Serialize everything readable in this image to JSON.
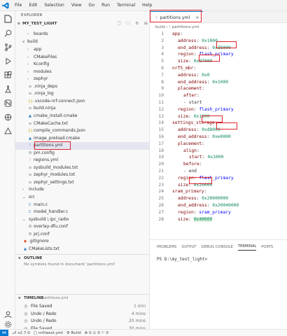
{
  "menu": [
    "File",
    "Edit",
    "Selection",
    "View",
    "Go",
    "Run",
    "Terminal",
    "Help"
  ],
  "sidebar": {
    "explorer_title": "EXPLORER",
    "project": "MY_TEST_LIGHT",
    "tree": [
      {
        "label": "boards",
        "icon": "folder",
        "depth": 2,
        "chev": ">"
      },
      {
        "label": "app",
        "icon": "folder",
        "depth": 2,
        "chev": ">"
      },
      {
        "label": "CMakeFiles",
        "icon": "folder",
        "depth": 2,
        "chev": ">"
      },
      {
        "label": "Kconfig",
        "icon": "folder",
        "depth": 2,
        "chev": ">"
      },
      {
        "label": "modules",
        "icon": "folder",
        "depth": 2,
        "chev": ">"
      },
      {
        "label": "zephyr",
        "icon": "folder",
        "depth": 2,
        "chev": ">"
      },
      {
        "label": ".ninja_deps",
        "icon": "file",
        "depth": 2
      },
      {
        "label": ".ninja_log",
        "icon": "file",
        "depth": 2
      },
      {
        "label": ".vscode-nrf-connect.json",
        "icon": "json",
        "depth": 2
      },
      {
        "label": "build.ninja",
        "icon": "file",
        "depth": 2
      },
      {
        "label": "cmake_install.cmake",
        "icon": "cmake",
        "depth": 2
      },
      {
        "label": "CMakeCache.txt",
        "icon": "file",
        "depth": 2
      },
      {
        "label": "compile_commands.json",
        "icon": "json",
        "depth": 2
      },
      {
        "label": "image_preload.cmake",
        "icon": "cmake",
        "depth": 2
      },
      {
        "label": "partitions.yml",
        "icon": "yml",
        "depth": 2
      },
      {
        "label": "pm.config",
        "icon": "gear",
        "depth": 2
      },
      {
        "label": "regions.yml",
        "icon": "yml",
        "depth": 2
      },
      {
        "label": "sysbuild_modules.txt",
        "icon": "file",
        "depth": 2
      },
      {
        "label": "zephyr_modules.txt",
        "icon": "file",
        "depth": 2
      },
      {
        "label": "zephyr_settings.txt",
        "icon": "file",
        "depth": 2
      },
      {
        "label": "include",
        "icon": "folder",
        "depth": 1,
        "chev": ">"
      },
      {
        "label": "src",
        "icon": "folder",
        "depth": 1,
        "chev": "v"
      },
      {
        "label": "main.c",
        "icon": "c",
        "depth": 2
      },
      {
        "label": "model_handler.c",
        "icon": "c",
        "depth": 2
      },
      {
        "label": "sysbuild \\ ipc_radio",
        "icon": "folder",
        "depth": 1,
        "chev": "v"
      },
      {
        "label": "overlay-dfu.conf",
        "icon": "gear",
        "depth": 2
      },
      {
        "label": "prj.conf",
        "icon": "gear",
        "depth": 2
      },
      {
        "label": ".gitignore",
        "icon": "git",
        "depth": 1
      },
      {
        "label": "CMakeLists.txt",
        "icon": "cmake",
        "depth": 1
      }
    ],
    "build_label": "build",
    "outline_title": "OUTLINE",
    "outline_message": "No symbols found in document 'partitions.yml'",
    "timeline_title": "TIMELINE",
    "timeline_file": "partitions.yml",
    "timeline": [
      {
        "label": "File Saved",
        "time": "1 min"
      },
      {
        "label": "Undo / Redo",
        "time": "4 mins"
      },
      {
        "label": "Undo / Redo",
        "time": "20 mins"
      },
      {
        "label": "File Saved",
        "time": "30 mins"
      }
    ]
  },
  "editor": {
    "tab_label": "partitions.yml",
    "breadcrumb": [
      "build",
      "partitions.yml"
    ],
    "lines": [
      {
        "n": "1",
        "indent": 0,
        "key": "app",
        "val": "",
        "hl": false
      },
      {
        "n": "2",
        "indent": 1,
        "key": "address",
        "val": "0x1000",
        "hl": false
      },
      {
        "n": "3",
        "indent": 1,
        "key": "end_address",
        "val": "0xd8000",
        "hl": false
      },
      {
        "n": "4",
        "indent": 1,
        "key": "region",
        "val": "flash_primary",
        "str": true,
        "hl": false
      },
      {
        "n": "5",
        "indent": 1,
        "key": "size",
        "val": "0xd7000",
        "hl": false
      },
      {
        "n": "6",
        "indent": 0,
        "key": "nrf5_mbr",
        "val": "",
        "hl": false
      },
      {
        "n": "7",
        "indent": 1,
        "key": "address",
        "val": "0x0",
        "hl": false
      },
      {
        "n": "8",
        "indent": 1,
        "key": "end_address",
        "val": "0x1000",
        "hl": false
      },
      {
        "n": "9",
        "indent": 1,
        "key": "placement",
        "val": "",
        "hl": false
      },
      {
        "n": "10",
        "indent": 2,
        "key": "after",
        "val": "",
        "hl": false
      },
      {
        "n": "11",
        "indent": 2,
        "key": "- start",
        "val": "",
        "plain": true,
        "hl": false
      },
      {
        "n": "12",
        "indent": 1,
        "key": "region",
        "val": "flash_primary",
        "str": true,
        "hl": false
      },
      {
        "n": "13",
        "indent": 1,
        "key": "size",
        "val": "0x1000",
        "hl": false
      },
      {
        "n": "14",
        "indent": 0,
        "key": "settings_storage",
        "val": "",
        "hl": false
      },
      {
        "n": "15",
        "indent": 1,
        "key": "address",
        "val": "0xd8000",
        "hl": false
      },
      {
        "n": "16",
        "indent": 1,
        "key": "end_address",
        "val": "0xe0000",
        "hl": false
      },
      {
        "n": "17",
        "indent": 1,
        "key": "placement",
        "val": "",
        "hl": false
      },
      {
        "n": "18",
        "indent": 2,
        "key": "align",
        "val": "",
        "hl": false
      },
      {
        "n": "19",
        "indent": 3,
        "key": "start",
        "val": "0x1000",
        "hl": false
      },
      {
        "n": "20",
        "indent": 2,
        "key": "before",
        "val": "",
        "hl": false
      },
      {
        "n": "21",
        "indent": 2,
        "key": "- end",
        "val": "",
        "plain": true,
        "hl": false
      },
      {
        "n": "22",
        "indent": 1,
        "key": "region",
        "val": "flash_primary",
        "str": true,
        "hl": false
      },
      {
        "n": "23",
        "indent": 1,
        "key": "size",
        "val": "0x20000",
        "hl": false
      },
      {
        "n": "24",
        "indent": 0,
        "key": "sram_primary",
        "val": "",
        "hl": false
      },
      {
        "n": "25",
        "indent": 1,
        "key": "address",
        "val": "0x20000000",
        "hl": false
      },
      {
        "n": "26",
        "indent": 1,
        "key": "end_address",
        "val": "0x20040000",
        "hl": false
      },
      {
        "n": "27",
        "indent": 1,
        "key": "region",
        "val": "sram_primary",
        "str": true,
        "hl": false
      },
      {
        "n": "28",
        "indent": 1,
        "key": "size",
        "val": "0x40000",
        "hl": true
      }
    ]
  },
  "panel": {
    "tabs": [
      "PROBLEMS",
      "OUTPUT",
      "DEBUG CONSOLE",
      "TERMINAL",
      "PORTS"
    ],
    "active_tab": "TERMINAL",
    "prompt": "PS D:\\my_test_light>"
  },
  "status": {
    "version": "v2.7.0",
    "board": "nrf/west.yml",
    "build": "Build",
    "counts": [
      "0",
      "0",
      "0"
    ]
  },
  "colors": {
    "accent": "#0078d4",
    "annotation": "#e0242c",
    "key": "#800000",
    "value": "#098658",
    "string": "#0000ff"
  }
}
